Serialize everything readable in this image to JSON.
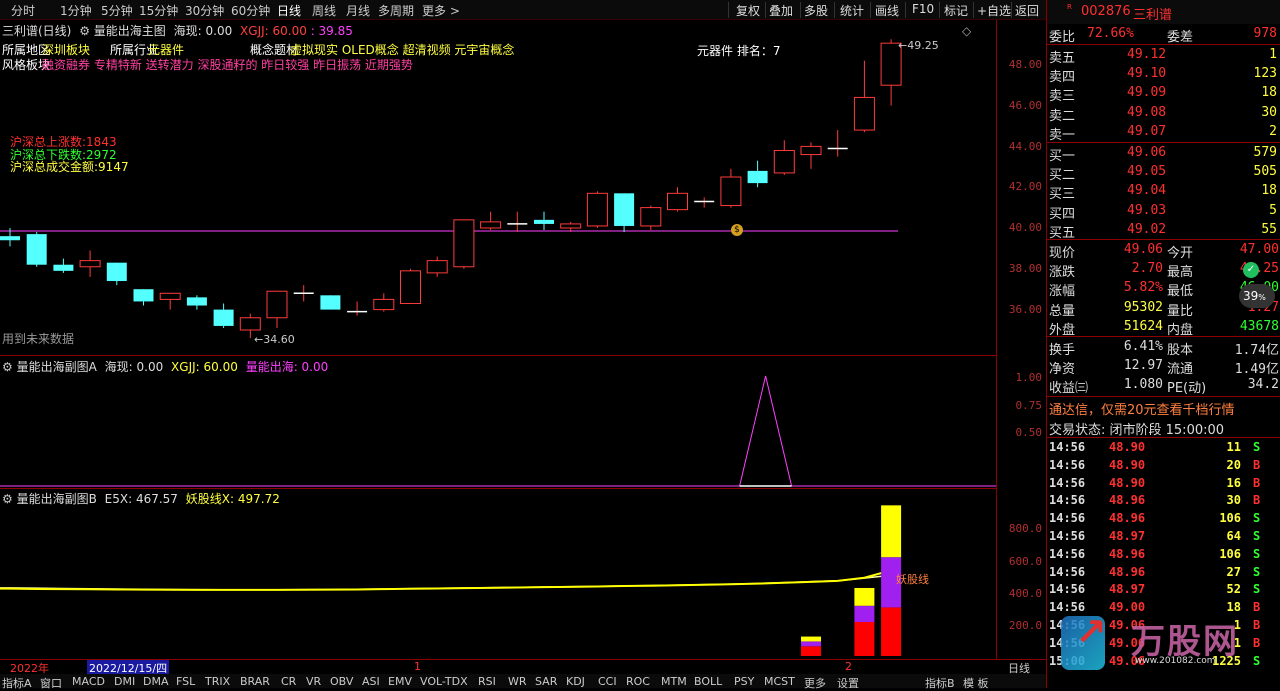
{
  "toolbar": {
    "periods": [
      "分时",
      "1分钟",
      "5分钟",
      "15分钟",
      "30分钟",
      "60分钟",
      "日线",
      "周线",
      "月线",
      "多周期",
      "更多 >"
    ],
    "tools": [
      "复权",
      "叠加",
      "多股",
      "统计",
      "画线",
      "F10",
      "标记",
      "+自选",
      "返回"
    ]
  },
  "main": {
    "stock_label": "三利谱(日线)",
    "indicator_name": "量能出海主图",
    "ind_label1": "海现: 0.00",
    "ind_label2": "XGJJ: 60.00",
    "ind_label3": ": 39.85",
    "region_label": "所属地区",
    "region_value": "深圳板块",
    "industry_label": "所属行业",
    "industry_value": "元器件",
    "concept_label": "概念题材",
    "concept_value": "虚拟现实 OLED概念 超清视频 元宇宙概念",
    "rank_text": "元器件 排名：7",
    "style_label": "风格板块",
    "style_value": "融资融券 专精特新 送转潜力 深股通籽的 昨日较强 昨日振荡 近期强势",
    "up_count": "沪深总上涨数:1843",
    "down_count": "沪深总下跌数:2972",
    "turnover": "沪深总成交金额:9147",
    "future_note": "用到未来数据",
    "high_label": "49.25",
    "low_label": "34.60",
    "yaxis": [
      "48.00",
      "46.00",
      "44.00",
      "42.00",
      "40.00",
      "38.00",
      "36.00"
    ],
    "hline": 39.85
  },
  "sub1": {
    "name": "量能出海副图A",
    "l1": "海现: 0.00",
    "l2": "XGJJ: 60.00",
    "l3": "量能出海: 0.00",
    "yaxis": [
      "1.00",
      "0.75",
      "0.50"
    ]
  },
  "sub2": {
    "name": "量能出海副图B",
    "l1": "E5X: 467.57",
    "l2": "妖股线X: 497.72",
    "line_label": "妖股线",
    "yaxis": [
      "800.0",
      "600.0",
      "400.0",
      "200.0"
    ]
  },
  "datebar": {
    "year": "2022年",
    "date": "2022/12/15/四",
    "m1": "1",
    "m2": "2",
    "period": "日线"
  },
  "tabs": [
    "指标A",
    "窗口",
    "MACD",
    "DMI",
    "DMA",
    "FSL",
    "TRIX",
    "BRAR",
    "CR",
    "VR",
    "OBV",
    "ASI",
    "EMV",
    "VOL-TDX",
    "RSI",
    "WR",
    "SAR",
    "KDJ",
    "CCI",
    "ROC",
    "MTM",
    "BOLL",
    "PSY",
    "MCST",
    "更多",
    "设置",
    "指标B",
    "模 板"
  ],
  "right": {
    "code": "002876",
    "name": "三利谱",
    "wb_label": "委比",
    "wb_value": "72.66%",
    "wc_label": "委差",
    "wc_value": "978",
    "sells": [
      {
        "l": "卖五",
        "p": "49.12",
        "v": "1"
      },
      {
        "l": "卖四",
        "p": "49.10",
        "v": "123"
      },
      {
        "l": "卖三",
        "p": "49.09",
        "v": "18"
      },
      {
        "l": "卖二",
        "p": "49.08",
        "v": "30"
      },
      {
        "l": "卖一",
        "p": "49.07",
        "v": "2"
      }
    ],
    "buys": [
      {
        "l": "买一",
        "p": "49.06",
        "v": "579"
      },
      {
        "l": "买二",
        "p": "49.05",
        "v": "505"
      },
      {
        "l": "买三",
        "p": "49.04",
        "v": "18"
      },
      {
        "l": "买四",
        "p": "49.03",
        "v": "5"
      },
      {
        "l": "买五",
        "p": "49.02",
        "v": "55"
      }
    ],
    "stats": [
      {
        "l1": "现价",
        "v1": "49.06",
        "l2": "今开",
        "v2": "47.00"
      },
      {
        "l1": "涨跌",
        "v1": "2.70",
        "l2": "最高",
        "v2": "49.25"
      },
      {
        "l1": "涨幅",
        "v1": "5.82%",
        "l2": "最低",
        "v2": "46.00"
      },
      {
        "l1": "总量",
        "v1": "95302",
        "l2": "量比",
        "v2": "1.27"
      },
      {
        "l1": "外盘",
        "v1": "51624",
        "l2": "内盘",
        "v2": "43678"
      }
    ],
    "stats2": [
      {
        "l1": "换手",
        "v1": "6.41%",
        "l2": "股本",
        "v2": "1.74亿"
      },
      {
        "l1": "净资",
        "v1": "12.97",
        "l2": "流通",
        "v2": "1.49亿"
      },
      {
        "l1": "收益㈢",
        "v1": "1.080",
        "l2": "PE(动)",
        "v2": "34.2"
      }
    ],
    "promo": "通达信，仅需20元查看千档行情",
    "trade_state": "交易状态: 闭市阶段 15:00:00",
    "ticks": [
      {
        "t": "14:56",
        "p": "48.90",
        "v": "11",
        "s": "S"
      },
      {
        "t": "14:56",
        "p": "48.90",
        "v": "20",
        "s": "B"
      },
      {
        "t": "14:56",
        "p": "48.90",
        "v": "16",
        "s": "B"
      },
      {
        "t": "14:56",
        "p": "48.96",
        "v": "30",
        "s": "B"
      },
      {
        "t": "14:56",
        "p": "48.96",
        "v": "106",
        "s": "S"
      },
      {
        "t": "14:56",
        "p": "48.97",
        "v": "64",
        "s": "S"
      },
      {
        "t": "14:56",
        "p": "48.96",
        "v": "106",
        "s": "S"
      },
      {
        "t": "14:56",
        "p": "48.96",
        "v": "27",
        "s": "S"
      },
      {
        "t": "14:56",
        "p": "48.97",
        "v": "52",
        "s": "S"
      },
      {
        "t": "14:56",
        "p": "49.00",
        "v": "18",
        "s": "B"
      },
      {
        "t": "14:56",
        "p": "49.06",
        "v": "1",
        "s": "B"
      },
      {
        "t": "14:56",
        "p": "49.06",
        "v": "1",
        "s": "B"
      },
      {
        "t": "15:00",
        "p": "49.06",
        "v": "1225",
        "s": "S"
      }
    ],
    "badge": "39",
    "watermark": "万股网",
    "watermark_url": "www.201082.com"
  },
  "chart_data": {
    "type": "candlestick",
    "candles": [
      [
        39.6,
        40.0,
        39.1,
        39.4
      ],
      [
        39.7,
        39.8,
        38.1,
        38.2
      ],
      [
        38.2,
        38.5,
        37.8,
        37.9
      ],
      [
        38.1,
        38.9,
        37.6,
        38.4
      ],
      [
        38.3,
        38.3,
        37.2,
        37.4
      ],
      [
        37.0,
        37.0,
        36.2,
        36.4
      ],
      [
        36.5,
        36.8,
        36.0,
        36.8
      ],
      [
        36.6,
        36.7,
        36.0,
        36.2
      ],
      [
        36.0,
        36.3,
        35.1,
        35.2
      ],
      [
        35.0,
        35.8,
        34.6,
        35.6
      ],
      [
        35.6,
        36.9,
        35.1,
        36.9
      ],
      [
        36.8,
        37.2,
        36.4,
        36.8
      ],
      [
        36.7,
        36.7,
        36.1,
        36.0
      ],
      [
        35.8,
        36.4,
        35.7,
        35.9
      ],
      [
        36.0,
        36.8,
        35.9,
        36.5
      ],
      [
        36.3,
        38.0,
        36.3,
        37.9
      ],
      [
        37.8,
        38.6,
        37.6,
        38.4
      ],
      [
        38.1,
        40.4,
        38.0,
        40.4
      ],
      [
        40.0,
        40.8,
        39.9,
        40.3
      ],
      [
        40.2,
        40.8,
        39.8,
        40.2
      ],
      [
        40.4,
        40.8,
        39.9,
        40.2
      ],
      [
        40.0,
        40.3,
        39.8,
        40.2
      ],
      [
        40.1,
        41.8,
        40.0,
        41.7
      ],
      [
        41.7,
        41.7,
        39.8,
        40.1
      ],
      [
        40.1,
        41.1,
        39.9,
        41.0
      ],
      [
        40.9,
        42.0,
        40.8,
        41.7
      ],
      [
        41.2,
        41.5,
        41.0,
        41.3
      ],
      [
        41.1,
        42.9,
        41.0,
        42.5
      ],
      [
        42.8,
        43.3,
        42.0,
        42.2
      ],
      [
        42.7,
        44.3,
        42.6,
        43.8
      ],
      [
        43.6,
        44.2,
        42.9,
        44.0
      ],
      [
        43.9,
        44.8,
        43.5,
        43.9
      ],
      [
        44.8,
        48.2,
        44.7,
        46.4
      ],
      [
        47.0,
        49.25,
        46.0,
        49.06
      ]
    ],
    "volume_b": [
      [
        0,
        0,
        0
      ],
      [
        0,
        0,
        0
      ],
      [
        0,
        0,
        0
      ],
      [
        0,
        0,
        0
      ],
      [
        0,
        0,
        0
      ],
      [
        0,
        0,
        0
      ],
      [
        0,
        0,
        0
      ],
      [
        0,
        0,
        0
      ],
      [
        0,
        0,
        0
      ],
      [
        0,
        0,
        0
      ],
      [
        0,
        0,
        0
      ],
      [
        0,
        0,
        0
      ],
      [
        0,
        0,
        0
      ],
      [
        0,
        0,
        0
      ],
      [
        0,
        0,
        0
      ],
      [
        0,
        0,
        0
      ],
      [
        0,
        0,
        0
      ],
      [
        0,
        0,
        0
      ],
      [
        0,
        0,
        0
      ],
      [
        0,
        0,
        0
      ],
      [
        0,
        0,
        0
      ],
      [
        0,
        0,
        0
      ],
      [
        0,
        0,
        0
      ],
      [
        0,
        0,
        0
      ],
      [
        0,
        0,
        0
      ],
      [
        0,
        0,
        0
      ],
      [
        0,
        0,
        0
      ],
      [
        0,
        0,
        0
      ],
      [
        0,
        0,
        0
      ],
      [
        0,
        0,
        0
      ],
      [
        60,
        30,
        30
      ],
      [
        0,
        0,
        0
      ],
      [
        210,
        100,
        110
      ],
      [
        300,
        310,
        320
      ]
    ],
    "e5x": [
      390,
      388,
      386,
      384,
      383,
      381,
      380,
      379,
      378,
      378,
      378,
      379,
      380,
      381,
      383,
      385,
      387,
      389,
      391,
      393,
      395,
      397,
      399,
      402,
      404,
      407,
      410,
      413,
      417,
      422,
      428,
      434,
      450,
      467.57
    ],
    "yaoline": [
      385,
      383,
      382,
      381,
      380,
      379,
      378,
      377,
      377,
      377,
      377,
      378,
      379,
      380,
      382,
      384,
      386,
      388,
      390,
      392,
      394,
      396,
      398,
      401,
      403,
      406,
      409,
      412,
      416,
      421,
      427,
      433,
      452,
      497.72
    ],
    "sub1_signal_index": 28,
    "colors": {
      "up": "#ff3b3b",
      "down": "#54ffff",
      "line": "#ff40ff",
      "ma": "#ffff00"
    }
  }
}
